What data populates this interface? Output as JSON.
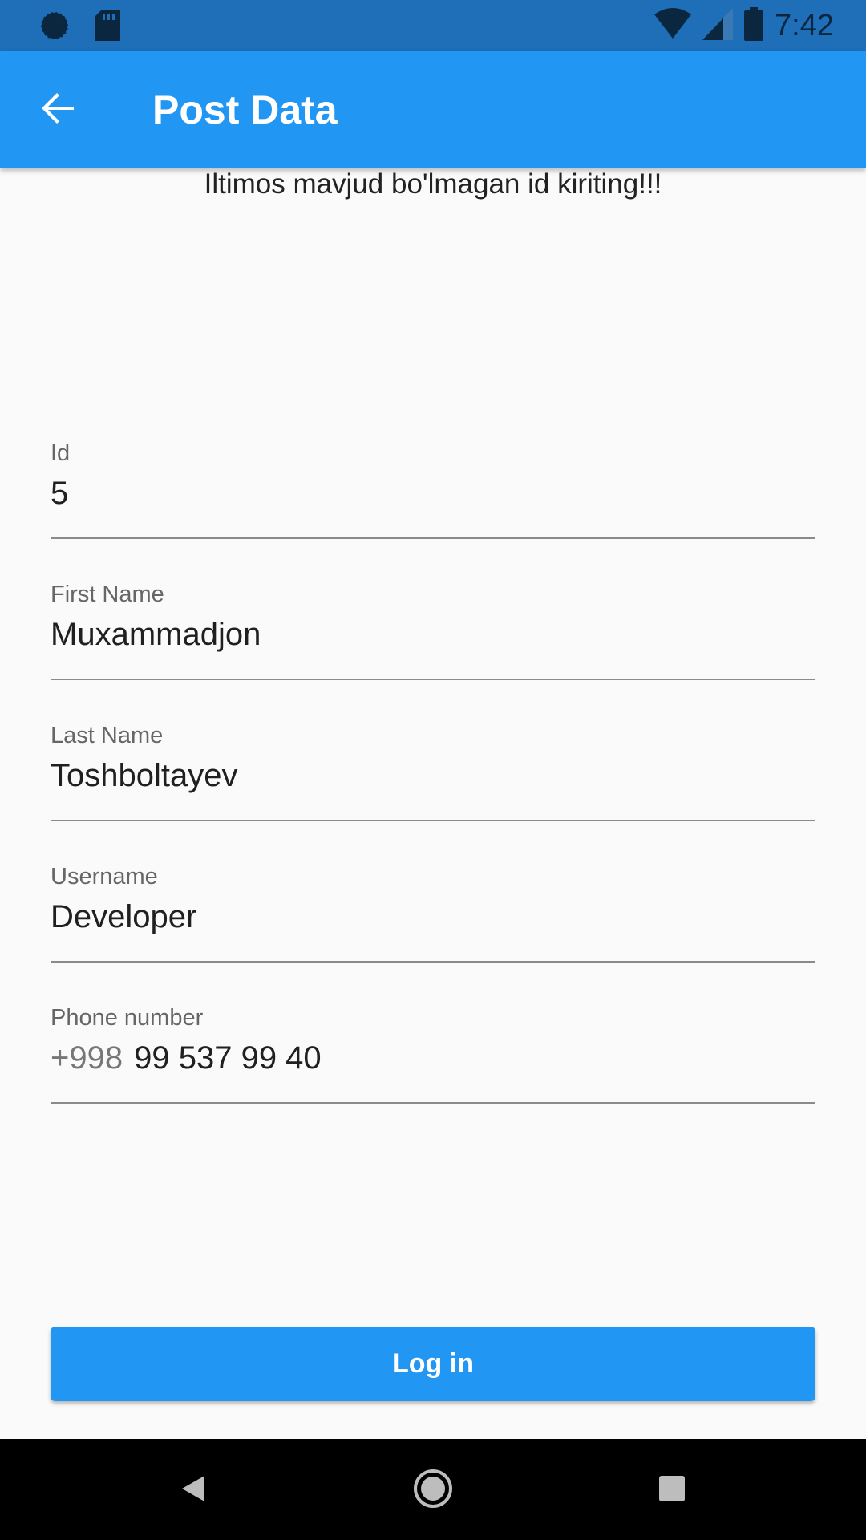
{
  "status_bar": {
    "time": "7:42",
    "icons": [
      "circle-notification-icon",
      "sd-card-icon",
      "wifi-icon",
      "cellular-signal-icon",
      "battery-icon"
    ]
  },
  "app_bar": {
    "title": "Post Data",
    "back_icon": "arrow-back-icon",
    "color": "#2196f3"
  },
  "notice": "Iltimos mavjud bo'lmagan id kiriting!!!",
  "form": {
    "fields": [
      {
        "label": "Id",
        "value": "5"
      },
      {
        "label": "First Name",
        "value": "Muxammadjon"
      },
      {
        "label": "Last Name",
        "value": "Toshboltayev"
      },
      {
        "label": "Username",
        "value": "Developer"
      },
      {
        "label": "Phone number",
        "prefix": "+998",
        "value": "99 537 99 40"
      }
    ]
  },
  "login_button": {
    "label": "Log in",
    "color": "#2196f3"
  },
  "nav_bar": {
    "icons": [
      "back-triangle-icon",
      "home-circle-icon",
      "recents-square-icon"
    ]
  }
}
